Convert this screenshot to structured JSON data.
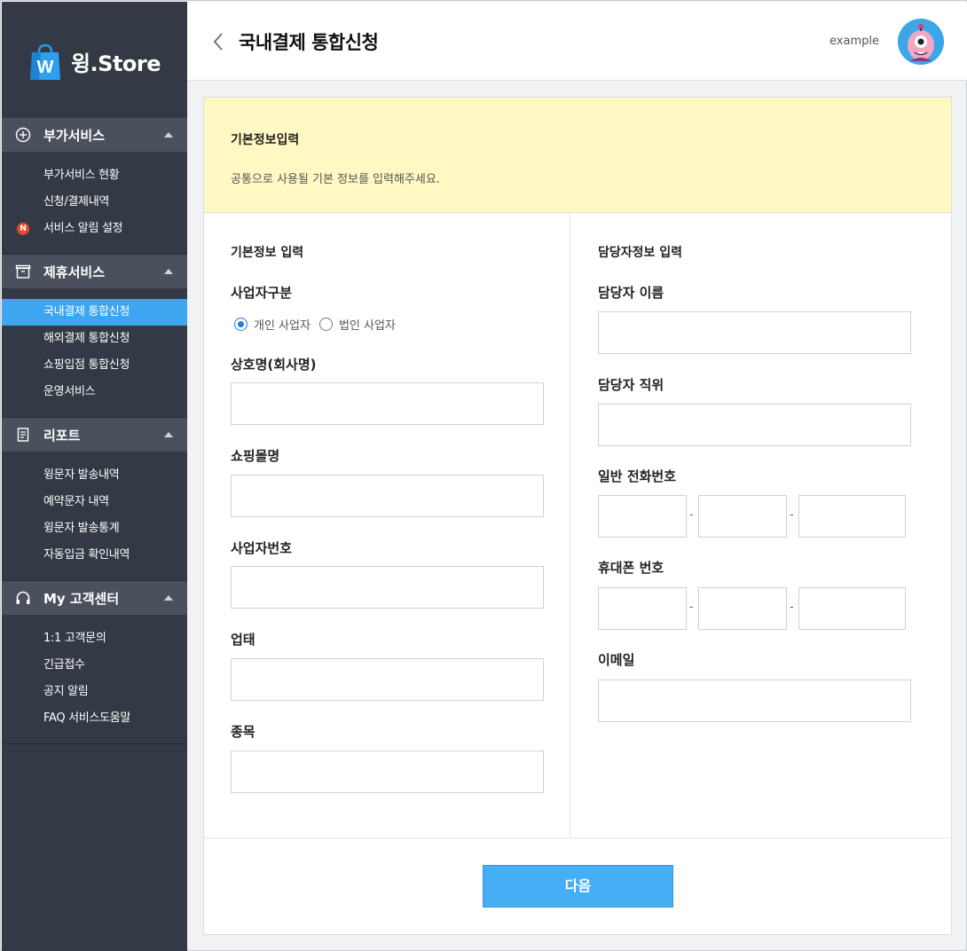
{
  "brand": {
    "name": "윙.Store",
    "logo_letter": "W"
  },
  "sidebar": {
    "sections": [
      {
        "title": "부가서비스",
        "icon": "plus-circle-icon",
        "items": [
          {
            "label": "부가서비스 현황",
            "active": false,
            "badge": ""
          },
          {
            "label": "신청/결제내역",
            "active": false,
            "badge": ""
          },
          {
            "label": "서비스 알림 설정",
            "active": false,
            "badge": "N"
          }
        ]
      },
      {
        "title": "제휴서비스",
        "icon": "box-icon",
        "items": [
          {
            "label": "국내결제 통합신청",
            "active": true,
            "badge": ""
          },
          {
            "label": "해외결제 통합신청",
            "active": false,
            "badge": ""
          },
          {
            "label": "쇼핑입점 통합신청",
            "active": false,
            "badge": ""
          },
          {
            "label": "운영서비스",
            "active": false,
            "badge": ""
          }
        ]
      },
      {
        "title": "리포트",
        "icon": "report-icon",
        "items": [
          {
            "label": "윙문자 발송내역",
            "active": false,
            "badge": ""
          },
          {
            "label": "예약문자 내역",
            "active": false,
            "badge": ""
          },
          {
            "label": "윙문자 발송통계",
            "active": false,
            "badge": ""
          },
          {
            "label": "자동입금 확인내역",
            "active": false,
            "badge": ""
          }
        ]
      },
      {
        "title": "My 고객센터",
        "icon": "headphones-icon",
        "items": [
          {
            "label": "1:1 고객문의",
            "active": false,
            "badge": ""
          },
          {
            "label": "긴급접수",
            "active": false,
            "badge": ""
          },
          {
            "label": "공지 알림",
            "active": false,
            "badge": ""
          },
          {
            "label": "FAQ 서비스도움말",
            "active": false,
            "badge": ""
          }
        ]
      }
    ]
  },
  "header": {
    "title": "국내결제 통합신청",
    "user": "example"
  },
  "notice": {
    "title": "기본정보입력",
    "description": "공통으로 사용될 기본 정보를 입력해주세요."
  },
  "left": {
    "group_title": "기본정보 입력",
    "business_type_label": "사업자구분",
    "business_type_options": [
      "개인 사업자",
      "법인 사업자"
    ],
    "business_type_selected": "개인 사업자",
    "company_label": "상호명(회사명)",
    "mall_label": "쇼핑몰명",
    "biz_number_label": "사업자번호",
    "biz_condition_label": "업태",
    "biz_item_label": "종목"
  },
  "right": {
    "group_title": "담당자정보 입력",
    "name_label": "담당자 이름",
    "position_label": "담당자 직위",
    "phone_label": "일반 전화번호",
    "mobile_label": "휴대폰 번호",
    "email_label": "이메일",
    "separator": "-"
  },
  "footer": {
    "next_label": "다음"
  },
  "colors": {
    "sidebar_bg": "#333a45",
    "active_item": "#3ea6f0",
    "notice_bg": "#fff8c2",
    "button_bg": "#45aef5"
  }
}
